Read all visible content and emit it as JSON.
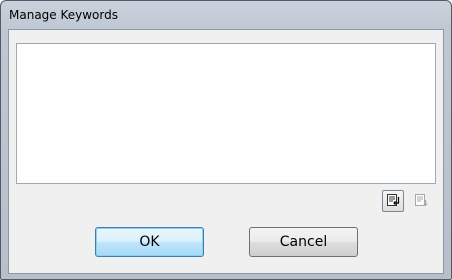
{
  "window": {
    "title": "Manage Keywords"
  },
  "toolbar": {
    "insert_icon": "insert-keyword-icon",
    "move_icon": "move-keyword-icon"
  },
  "buttons": {
    "ok_label": "OK",
    "cancel_label": "Cancel"
  },
  "colors": {
    "title_bar": "#c3ccd6",
    "client_background": "#f0f0f0",
    "default_button_border": "#3c7fb1"
  }
}
